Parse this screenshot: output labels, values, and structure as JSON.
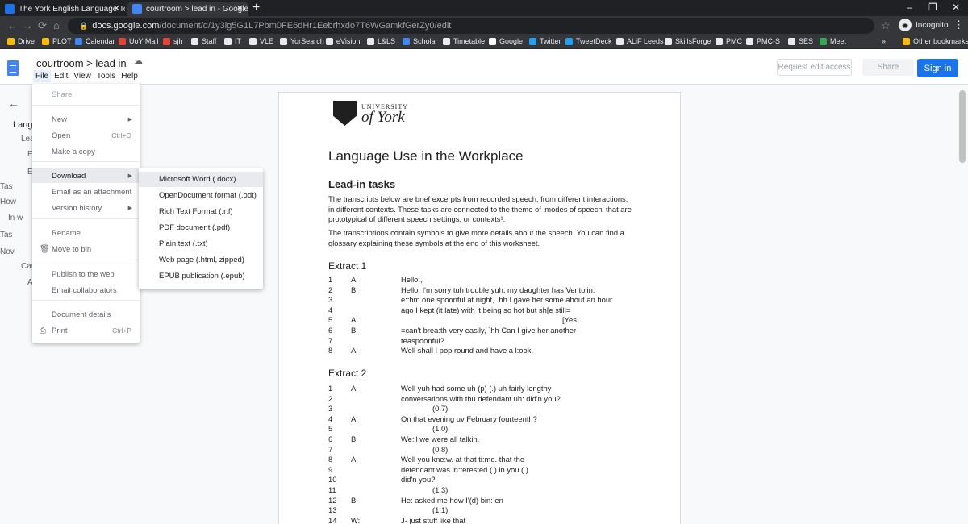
{
  "browser": {
    "tabs": [
      {
        "title": "The York English Language Toolk",
        "active": false
      },
      {
        "title": "courtroom > lead in - Google Do",
        "active": true
      }
    ],
    "new_tab": "+",
    "url_host": "docs.google.com",
    "url_path": "/document/d/1y3ig5G1L7Pbm0FE6dHr1Eebrhxdo7T6WGamkfGerZy0/edit",
    "incognito_label": "Incognito",
    "bookmarks": [
      {
        "label": "Drive",
        "color": "#fbbc04"
      },
      {
        "label": "PLOT",
        "color": "#fbbc04"
      },
      {
        "label": "Calendar",
        "color": "#4285f4"
      },
      {
        "label": "UoY Mail",
        "color": "#ea4335"
      },
      {
        "label": "sjh",
        "color": "#ea4335"
      },
      {
        "label": "Staff",
        "color": "#e8eaed"
      },
      {
        "label": "IT",
        "color": "#e8eaed"
      },
      {
        "label": "VLE",
        "color": "#e8eaed"
      },
      {
        "label": "YorSearch",
        "color": "#e8eaed"
      },
      {
        "label": "eVision",
        "color": "#e8eaed"
      },
      {
        "label": "L&LS",
        "color": "#e8eaed"
      },
      {
        "label": "Scholar",
        "color": "#4285f4"
      },
      {
        "label": "Timetable",
        "color": "#e8eaed"
      },
      {
        "label": "Google",
        "color": "#ffffff"
      },
      {
        "label": "Twitter",
        "color": "#1da1f2"
      },
      {
        "label": "TweetDeck",
        "color": "#1da1f2"
      },
      {
        "label": "ALiF Leeds",
        "color": "#e8eaed"
      },
      {
        "label": "SkillsForge",
        "color": "#e8eaed"
      },
      {
        "label": "PMC",
        "color": "#e8eaed"
      },
      {
        "label": "PMC-S",
        "color": "#e8eaed"
      },
      {
        "label": "SES",
        "color": "#e8eaed"
      },
      {
        "label": "Meet",
        "color": "#34a853"
      }
    ],
    "bookmarks_more": "»",
    "other_bookmarks": "Other bookmarks"
  },
  "docs": {
    "title": "courtroom > lead in",
    "menus": [
      "File",
      "Edit",
      "View",
      "Tools",
      "Help"
    ],
    "request_edit": "Request edit access",
    "share": "Share",
    "sign_in": "Sign in"
  },
  "outline": {
    "back": "←",
    "items": [
      "Langu",
      "Lea",
      "E",
      "E",
      "Tas",
      "How",
      "In w",
      "Tas",
      "Nov",
      "Can",
      "A"
    ]
  },
  "file_menu": {
    "items": [
      {
        "label": "Share",
        "dim": true
      },
      {
        "label": "New",
        "arrow": true
      },
      {
        "label": "Open",
        "shortcut": "Ctrl+O"
      },
      {
        "label": "Make a copy"
      },
      {
        "label": "Download",
        "arrow": true,
        "highlight": true
      },
      {
        "label": "Email as an attachment"
      },
      {
        "label": "Version history",
        "arrow": true
      },
      {
        "label": "Rename"
      },
      {
        "label": "Move to bin",
        "icon": "bin"
      },
      {
        "label": "Publish to the web"
      },
      {
        "label": "Email collaborators"
      },
      {
        "label": "Document details"
      },
      {
        "label": "Print",
        "shortcut": "Ctrl+P",
        "icon": "print"
      }
    ]
  },
  "download_menu": [
    "Microsoft Word (.docx)",
    "OpenDocument format (.odt)",
    "Rich Text Format (.rtf)",
    "PDF document (.pdf)",
    "Plain text (.txt)",
    "Web page (.html, zipped)",
    "EPUB publication (.epub)"
  ],
  "document": {
    "logo_university": "UNIVERSITY",
    "logo_york": "of York",
    "title": "Language Use in the Workplace",
    "section": "Lead-in tasks",
    "para1": "The transcripts below are brief excerpts from recorded speech, from different interactions, in different contexts. These tasks are connected to the theme of 'modes of speech' that are prototypical of different speech settings, or contexts¹.",
    "para2": "The transcriptions contain symbols to give more details about the speech. You can find a glossary explaining these symbols at the end of this worksheet.",
    "extract1_title": "Extract 1",
    "extract1": [
      {
        "n": "1",
        "s": "A:",
        "t": "Hello:,"
      },
      {
        "n": "2",
        "s": "B:",
        "t": "Hello, I'm sorry tuh trouble yuh, my daughter has Ventolin:"
      },
      {
        "n": "3",
        "s": "",
        "t": "e::hm one spoonful at night, ˙hh I gave her some about an hour"
      },
      {
        "n": "4",
        "s": "",
        "t": "ago I kept (it late) with it being so hot but sh[e still="
      },
      {
        "n": "5",
        "s": "A:",
        "t": "[Yes,"
      },
      {
        "n": "6",
        "s": "B:",
        "t": "=can't brea:th very easily, ˙hh Can I give her another"
      },
      {
        "n": "7",
        "s": "",
        "t": "teaspoonful?"
      },
      {
        "n": "8",
        "s": "A:",
        "t": "Well shall I pop round and have a l:ook,"
      }
    ],
    "extract2_title": "Extract 2",
    "extract2": [
      {
        "n": "1",
        "s": "A:",
        "t": "Well yuh had some uh (p) (.) uh fairly lengthy"
      },
      {
        "n": "2",
        "s": "",
        "t": "conversations with thu defendant uh: did'n you?"
      },
      {
        "n": "3",
        "s": "",
        "t": "(0.7)"
      },
      {
        "n": "4",
        "s": "A:",
        "t": "On that evening uv February fourteenth?"
      },
      {
        "n": "5",
        "s": "",
        "t": "(1.0)"
      },
      {
        "n": "6",
        "s": "B:",
        "t": "We:ll we were all talkin."
      },
      {
        "n": "7",
        "s": "",
        "t": "(0.8)"
      },
      {
        "n": "8",
        "s": "A:",
        "t": "Well you kne:w. at that ti:me. that the"
      },
      {
        "n": "9",
        "s": "",
        "t": "defendant was in:terested (.) in you (.)"
      },
      {
        "n": "10",
        "s": "",
        "t": "did'n you?"
      },
      {
        "n": "11",
        "s": "",
        "t": "(1.3)"
      },
      {
        "n": "12",
        "s": "B:",
        "t": "He: asked me how I'(d) bin: en"
      },
      {
        "n": "13",
        "s": "",
        "t": "(1.1)"
      },
      {
        "n": "14",
        "s": "W:",
        "t": "J- just stuff like that"
      }
    ]
  }
}
